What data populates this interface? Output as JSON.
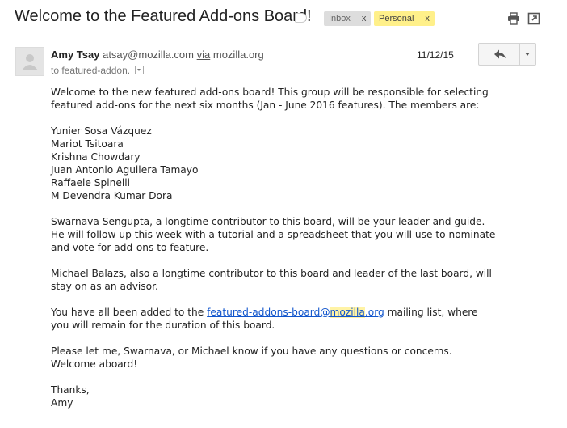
{
  "subject": "Welcome to the Featured Add-ons Board!",
  "labels": [
    {
      "text": "Inbox",
      "remove": "x"
    },
    {
      "text": "Personal",
      "remove": "x"
    }
  ],
  "toolbar": {
    "print_icon": "print-icon",
    "popout_icon": "new-window-icon"
  },
  "message": {
    "sender_name": "Amy Tsay",
    "sender_email": "atsay@mozilla.com",
    "via_label": "via",
    "via_domain": "mozilla.org",
    "recipients": "to featured-addon.",
    "date": "11/12/15",
    "reply_icon": "reply-icon",
    "more_icon": "chevron-down-icon"
  },
  "body": {
    "intro_1": "Welcome to the new featured add-ons board! This group will be responsible for selecting",
    "intro_2": "featured add-ons for the next six months (Jan - June 2016 features). The members are:",
    "members": [
      "Yunier Sosa Vázquez",
      "Mariot Tsitoara",
      "Krishna Chowdary",
      "Juan Antonio Aguilera Tamayo",
      "Raffaele Spinelli",
      "M Devendra Kumar Dora"
    ],
    "leader_1": "Swarnava Sengupta, a longtime contributor to this board, will be your leader and guide.",
    "leader_2": "He will follow up this week with a tutorial and a spreadsheet that you will use to nominate",
    "leader_3": "and vote for add-ons to feature.",
    "advisor_1": "Michael Balazs, also a longtime contributor to this board and leader of the last board, will",
    "advisor_2": "stay on as an advisor.",
    "list_prefix": "You have all been added to the ",
    "list_link_a": "featured-addons-board@",
    "list_link_b": "mozilla",
    "list_link_c": ".org",
    "list_suffix": " mailing list, where",
    "list_2": "you will remain for the duration of this board.",
    "questions_1": "Please let me, Swarnava, or Michael know if you have any questions or concerns.",
    "questions_2": "Welcome aboard!",
    "signoff": "Thanks,",
    "signature": "Amy"
  }
}
